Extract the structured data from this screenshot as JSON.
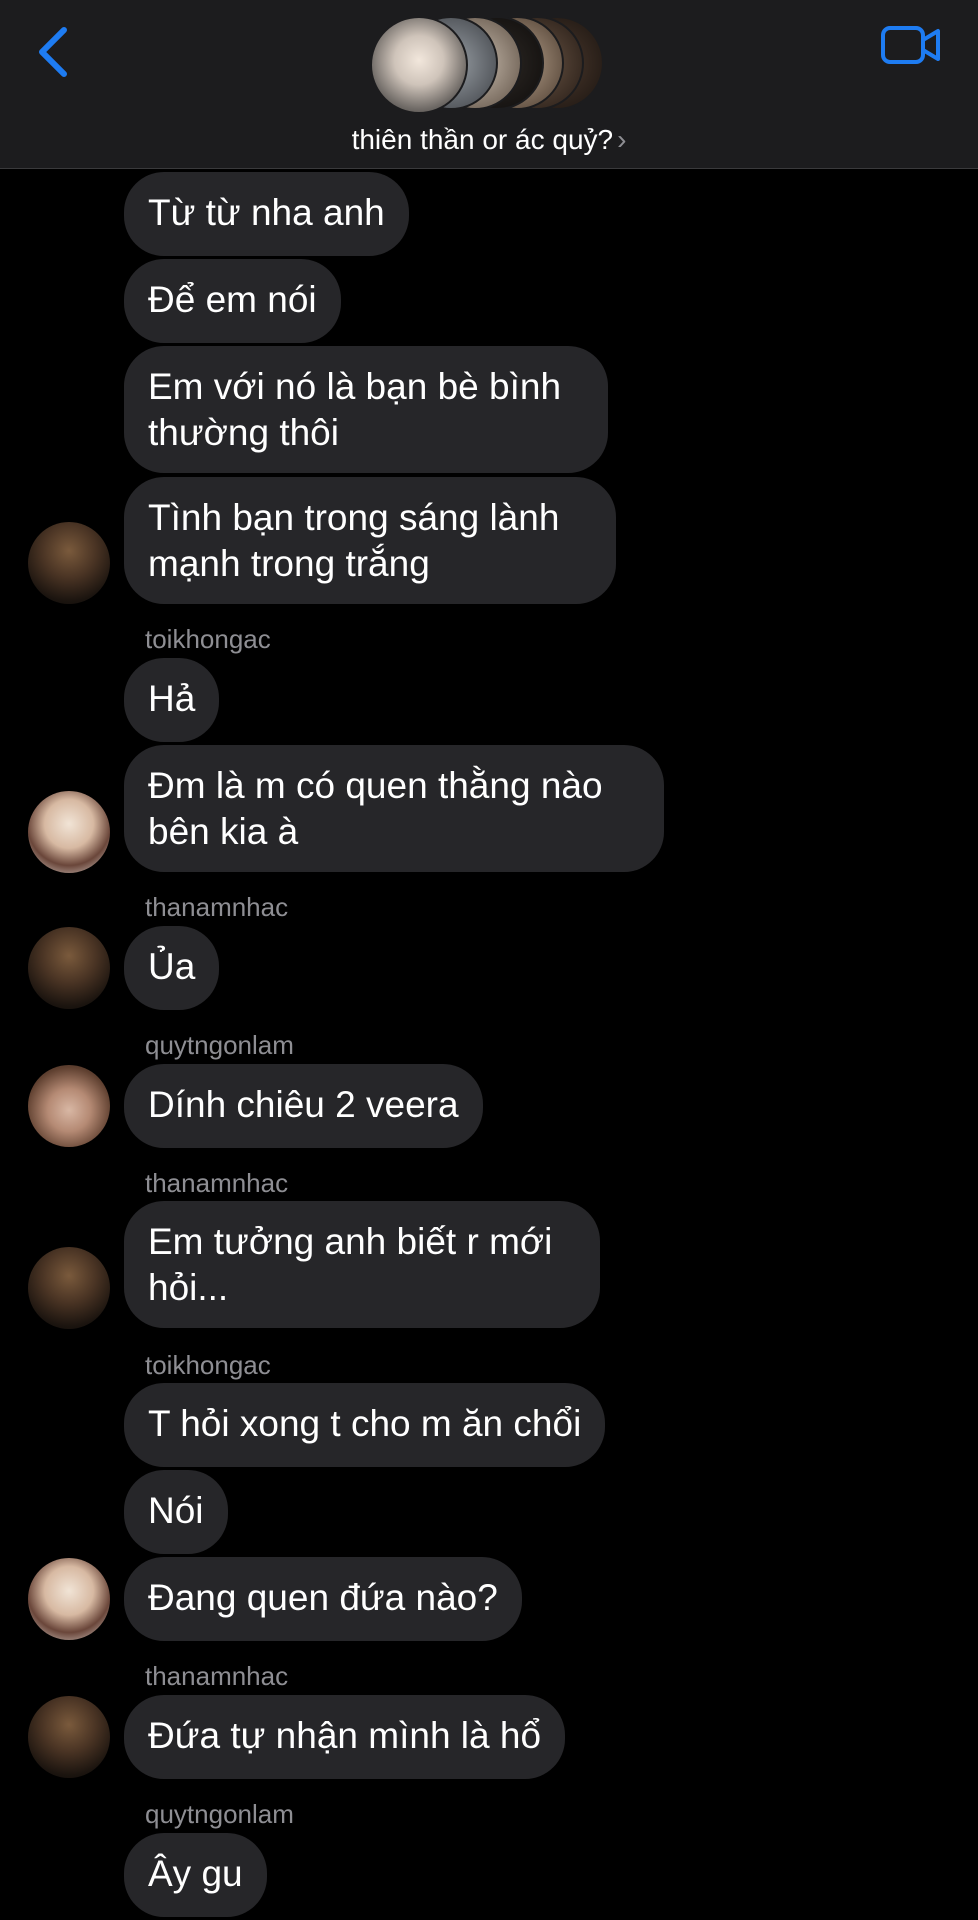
{
  "header": {
    "title": "thiên thần or ác quỷ?",
    "chevron": "›",
    "back_icon": "chevron-left-icon",
    "video_icon": "video-camera-icon",
    "accent_color": "#1e7cf2"
  },
  "messages": {
    "m1": "Từ từ nha anh",
    "m2": "Để em nói",
    "m3": "Em với nó là bạn bè bình thường thôi",
    "m4": "Tình bạn trong sáng lành mạnh trong trắng",
    "s1": "toikhongac",
    "m5": "Hả",
    "m6": "Đm là m có quen thằng nào bên kia à",
    "s2": "thanamnhac",
    "m7": "Ủa",
    "s3": "quytngonlam",
    "m8": "Dính chiêu 2 veera",
    "s4": "thanamnhac",
    "m9": "Em tưởng anh biết r mới hỏi...",
    "s5": "toikhongac",
    "m10": "T hỏi xong t cho m ăn chổi",
    "m11": "Nói",
    "m12": "Đang quen đứa nào?",
    "s6": "thanamnhac",
    "m13": "Đứa tự nhận mình là hổ",
    "s7": "quytngonlam",
    "m14": "Ây gu"
  }
}
